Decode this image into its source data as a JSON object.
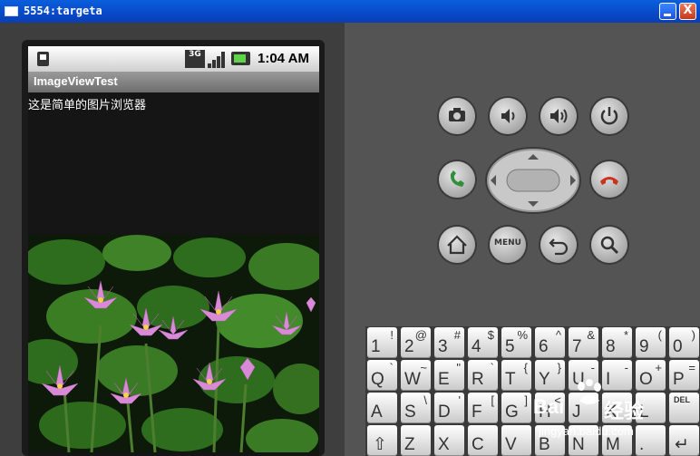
{
  "window": {
    "title": "5554:targeta",
    "close_glyph": "X"
  },
  "phone": {
    "status_bar": {
      "network": "3G",
      "time": "1:04 AM"
    },
    "app_title": "ImageViewTest",
    "message": "这是简单的图片浏览器",
    "image_subject": "pink water lilies among green lily pads"
  },
  "hardware_buttons": {
    "menu_label": "MENU",
    "icons": [
      "camera-icon",
      "volume-down-icon",
      "volume-up-icon",
      "power-icon",
      "call-icon",
      "end-call-icon",
      "home-icon",
      "menu-icon",
      "back-icon",
      "search-icon"
    ]
  },
  "keyboard": {
    "row1": [
      {
        "main": "1",
        "alt": "!"
      },
      {
        "main": "2",
        "alt": "@"
      },
      {
        "main": "3",
        "alt": "#"
      },
      {
        "main": "4",
        "alt": "$"
      },
      {
        "main": "5",
        "alt": "%"
      },
      {
        "main": "6",
        "alt": "^"
      },
      {
        "main": "7",
        "alt": "&"
      },
      {
        "main": "8",
        "alt": "*"
      },
      {
        "main": "9",
        "alt": "("
      },
      {
        "main": "0",
        "alt": ")"
      }
    ],
    "row2": [
      {
        "main": "Q",
        "alt": "`"
      },
      {
        "main": "W",
        "alt": "~"
      },
      {
        "main": "E",
        "alt": "\""
      },
      {
        "main": "R",
        "alt": "`"
      },
      {
        "main": "T",
        "alt": "{"
      },
      {
        "main": "Y",
        "alt": "}"
      },
      {
        "main": "U",
        "alt": "-"
      },
      {
        "main": "I",
        "alt": "-"
      },
      {
        "main": "O",
        "alt": "+"
      },
      {
        "main": "P",
        "alt": "="
      }
    ],
    "row3": [
      {
        "main": "A",
        "alt": ""
      },
      {
        "main": "S",
        "alt": "\\"
      },
      {
        "main": "D",
        "alt": "'"
      },
      {
        "main": "F",
        "alt": "["
      },
      {
        "main": "G",
        "alt": "]"
      },
      {
        "main": "H",
        "alt": "<"
      },
      {
        "main": "J",
        "alt": ""
      },
      {
        "main": "K",
        "alt": ""
      },
      {
        "main": "L",
        "alt": ""
      },
      {
        "main": "DEL",
        "alt": ""
      }
    ],
    "row4": [
      {
        "main": "⇧",
        "alt": ""
      },
      {
        "main": "Z",
        "alt": ""
      },
      {
        "main": "X",
        "alt": ""
      },
      {
        "main": "C",
        "alt": ""
      },
      {
        "main": "V",
        "alt": ""
      },
      {
        "main": "B",
        "alt": ""
      },
      {
        "main": "N",
        "alt": ""
      },
      {
        "main": "M",
        "alt": ""
      },
      {
        "main": ".",
        "alt": ""
      },
      {
        "main": "↵",
        "alt": ""
      }
    ]
  },
  "watermark": {
    "brand": "Bai",
    "brand_cn": "经验",
    "url": "jingyan.baidu.com"
  },
  "colors": {
    "titlebar": "#0849c8",
    "call_green": "#2f8f3a",
    "end_red": "#c8321f"
  }
}
